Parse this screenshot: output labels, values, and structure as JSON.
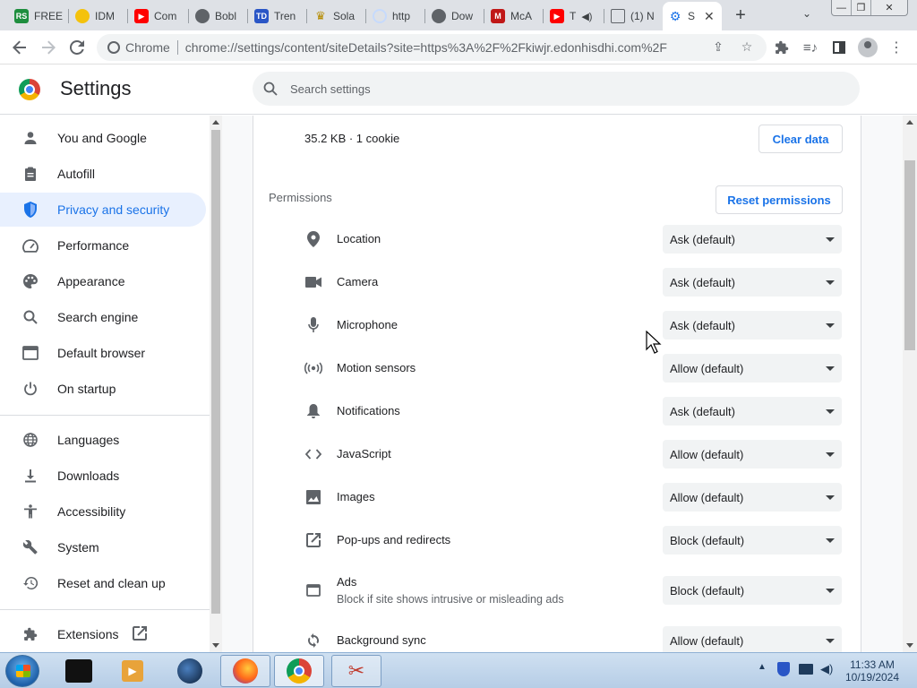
{
  "browser": {
    "tabs": [
      {
        "label": "FREE",
        "favicon": "rs-icon",
        "color": "#1e8e3e"
      },
      {
        "label": "IDM",
        "favicon": "globe-icon",
        "color": "#5f6368"
      },
      {
        "label": "Com",
        "favicon": "youtube-icon",
        "color": "#ff0000"
      },
      {
        "label": "Bobl",
        "favicon": "globe-icon",
        "color": "#5f6368"
      },
      {
        "label": "Tren",
        "favicon": "td-icon",
        "color": "#2a56c6"
      },
      {
        "label": "Sola",
        "favicon": "crown-icon",
        "color": "#b58b00"
      },
      {
        "label": "http",
        "favicon": "loading-icon",
        "color": "#9aa0a6"
      },
      {
        "label": "Dow",
        "favicon": "globe-icon",
        "color": "#5f6368"
      },
      {
        "label": "McA",
        "favicon": "mcafee-icon",
        "color": "#c01818"
      },
      {
        "label": "T",
        "favicon": "youtube-icon",
        "color": "#ff0000"
      },
      {
        "label": "(1) N",
        "favicon": "document-icon",
        "color": "#5f6368"
      },
      {
        "label": "S",
        "favicon": "gear-icon",
        "color": "#1a73e8"
      }
    ],
    "omnibox": {
      "chip": "Chrome",
      "url": "chrome://settings/content/siteDetails?site=https%3A%2F%2Fkiwjr.edonhisdhi.com%2F"
    }
  },
  "settings": {
    "title": "Settings",
    "search_placeholder": "Search settings",
    "nav": [
      {
        "label": "You and Google",
        "icon": "person-icon"
      },
      {
        "label": "Autofill",
        "icon": "clipboard-icon"
      },
      {
        "label": "Privacy and security",
        "icon": "shield-icon",
        "active": true
      },
      {
        "label": "Performance",
        "icon": "gauge-icon"
      },
      {
        "label": "Appearance",
        "icon": "palette-icon"
      },
      {
        "label": "Search engine",
        "icon": "search-icon"
      },
      {
        "label": "Default browser",
        "icon": "browser-icon"
      },
      {
        "label": "On startup",
        "icon": "power-icon"
      },
      {
        "label": "Languages",
        "icon": "globe-icon"
      },
      {
        "label": "Downloads",
        "icon": "download-icon"
      },
      {
        "label": "Accessibility",
        "icon": "accessibility-icon"
      },
      {
        "label": "System",
        "icon": "wrench-icon"
      },
      {
        "label": "Reset and clean up",
        "icon": "history-icon"
      },
      {
        "label": "Extensions",
        "icon": "puzzle-icon"
      }
    ]
  },
  "site": {
    "usage": "35.2 KB · 1 cookie",
    "clear_data": "Clear data",
    "permissions_title": "Permissions",
    "reset_permissions": "Reset permissions",
    "permissions": [
      {
        "label": "Location",
        "value": "Ask (default)",
        "icon": "location-icon"
      },
      {
        "label": "Camera",
        "value": "Ask (default)",
        "icon": "camera-icon"
      },
      {
        "label": "Microphone",
        "value": "Ask (default)",
        "icon": "microphone-icon"
      },
      {
        "label": "Motion sensors",
        "value": "Allow (default)",
        "icon": "sensors-icon"
      },
      {
        "label": "Notifications",
        "value": "Ask (default)",
        "icon": "bell-icon"
      },
      {
        "label": "JavaScript",
        "value": "Allow (default)",
        "icon": "code-icon"
      },
      {
        "label": "Images",
        "value": "Allow (default)",
        "icon": "image-icon"
      },
      {
        "label": "Pop-ups and redirects",
        "value": "Block (default)",
        "icon": "open-external-icon"
      },
      {
        "label": "Ads",
        "sublabel": "Block if site shows intrusive or misleading ads",
        "value": "Block (default)",
        "icon": "ads-icon"
      },
      {
        "label": "Background sync",
        "value": "Allow (default)",
        "icon": "sync-icon"
      }
    ]
  },
  "taskbar": {
    "time": "11:33 AM",
    "date": "10/19/2024"
  },
  "colors": {
    "accent": "#1a73e8",
    "nav_active_bg": "#e8f0fe",
    "select_bg": "#f1f3f4"
  }
}
